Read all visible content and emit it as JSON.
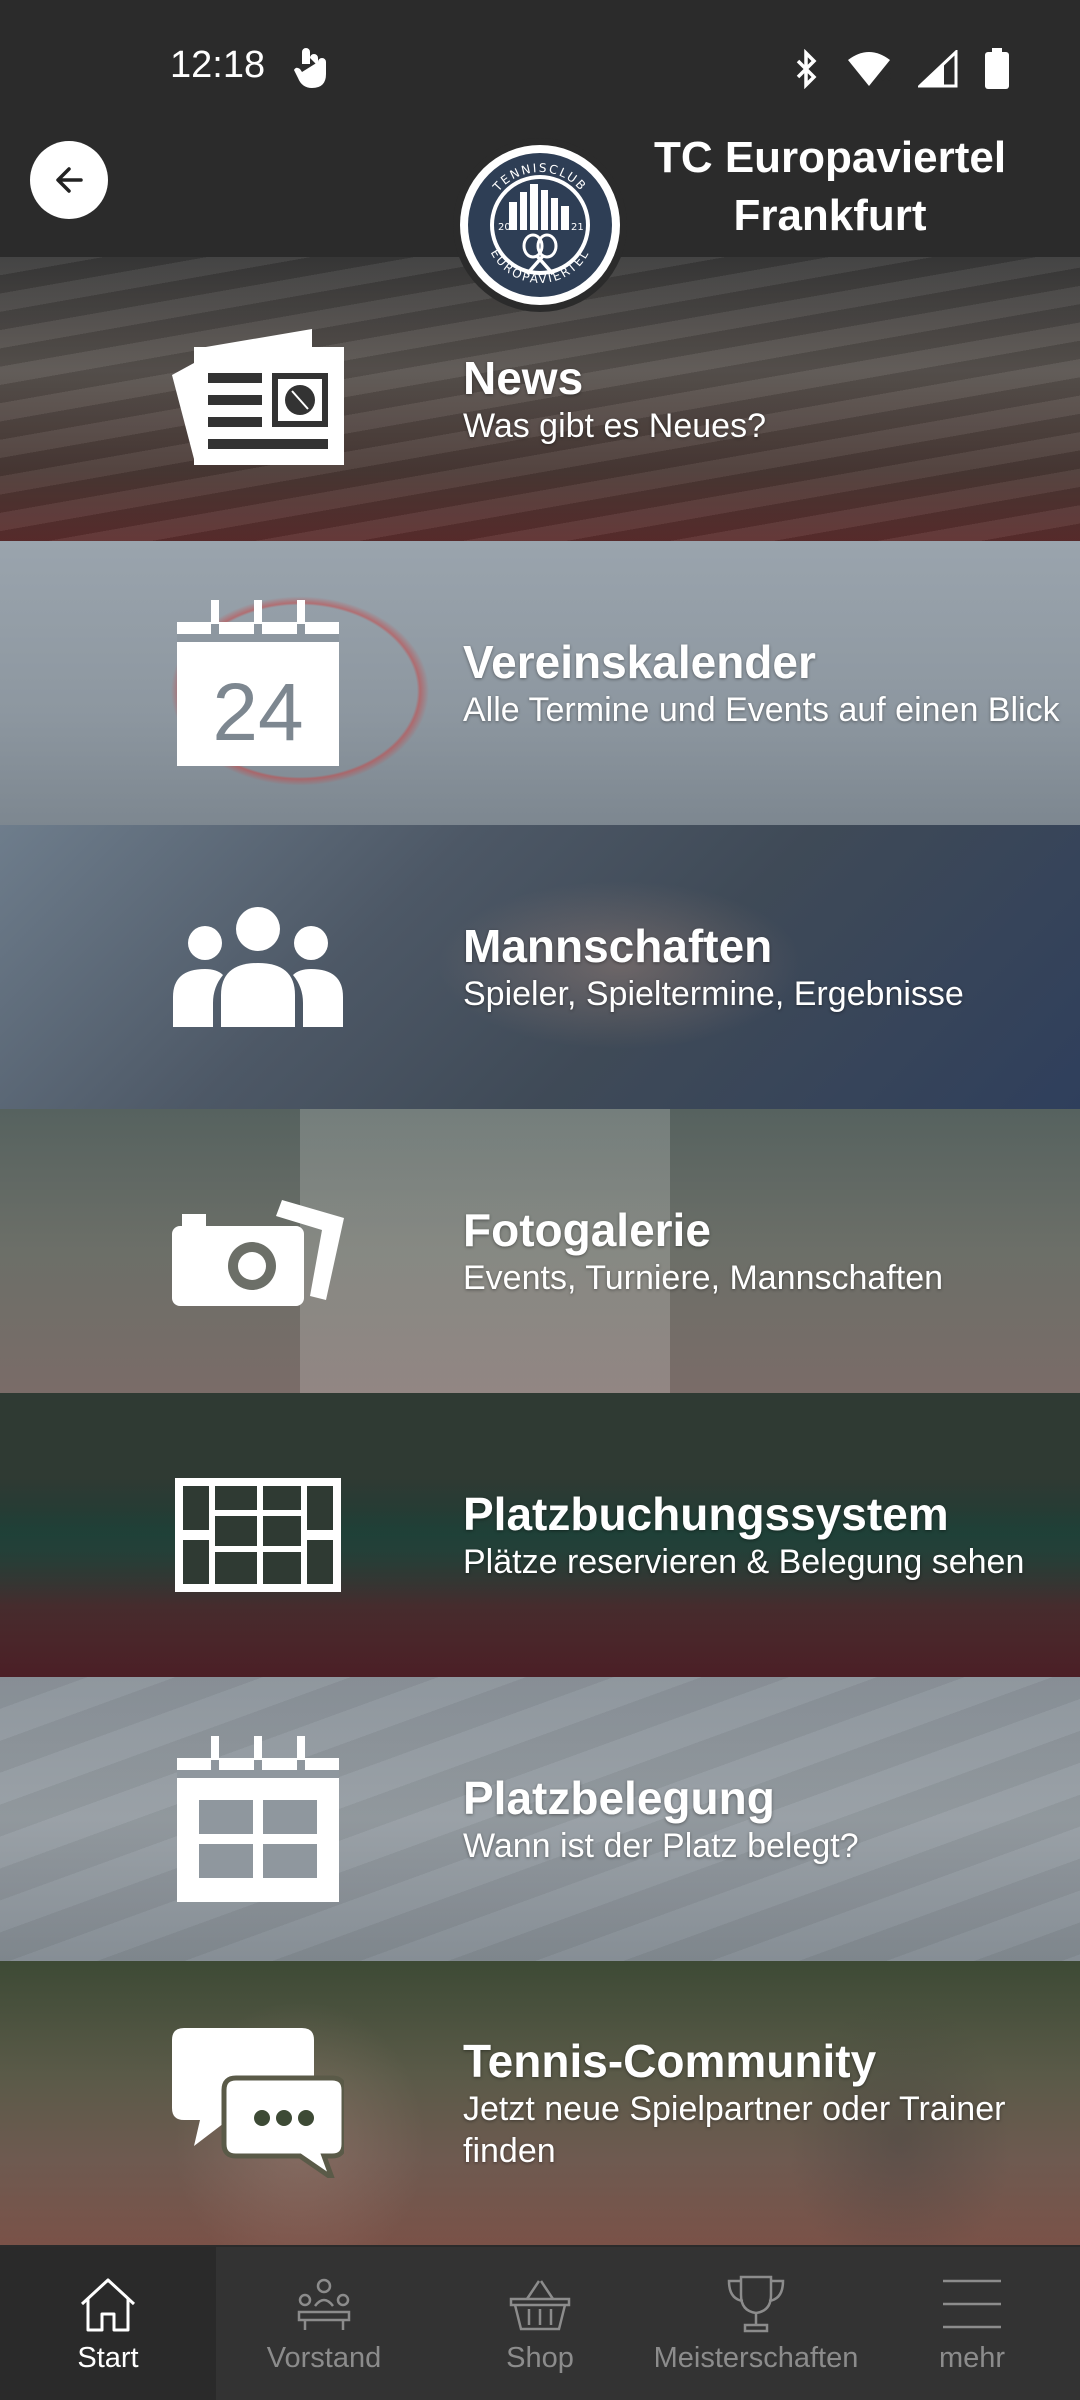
{
  "status": {
    "time": "12:18",
    "icons": [
      "gesture-icon",
      "bluetooth-icon",
      "wifi-icon",
      "signal-icon",
      "battery-icon"
    ]
  },
  "header": {
    "title": "TC Europaviertel Frankfurt",
    "logo": {
      "top_text": "TENNISCLUB",
      "bottom_text": "EUROPAVIERTEL",
      "year_left": "20",
      "year_right": "21"
    }
  },
  "menu": [
    {
      "title": "News",
      "subtitle": "Was gibt es Neues?",
      "icon": "newspaper-icon"
    },
    {
      "title": "Vereinskalender",
      "subtitle": "Alle Termine und Events auf einen Blick",
      "icon": "calendar-24-icon",
      "icon_number": "24"
    },
    {
      "title": "Mannschaften",
      "subtitle": "Spieler, Spieltermine, Ergebnisse",
      "icon": "team-icon"
    },
    {
      "title": "Fotogalerie",
      "subtitle": "Events, Turniere, Mannschaften",
      "icon": "camera-photos-icon"
    },
    {
      "title": "Platzbuchungssystem",
      "subtitle": "Plätze reservieren & Belegung sehen",
      "icon": "court-grid-icon"
    },
    {
      "title": "Platzbelegung",
      "subtitle": "Wann ist der Platz belegt?",
      "icon": "calendar-grid-icon"
    },
    {
      "title": "Tennis-Community",
      "subtitle": "Jetzt neue Spielpartner oder Trainer finden",
      "icon": "chat-bubbles-icon"
    }
  ],
  "nav": [
    {
      "label": "Start",
      "icon": "home-icon",
      "active": true
    },
    {
      "label": "Vorstand",
      "icon": "board-meeting-icon",
      "active": false
    },
    {
      "label": "Shop",
      "icon": "basket-icon",
      "active": false
    },
    {
      "label": "Meisterschaften",
      "icon": "trophy-icon",
      "active": false
    },
    {
      "label": "mehr",
      "icon": "menu-icon",
      "active": false
    }
  ],
  "colors": {
    "background": "#2b2b2b",
    "nav_bg": "#333333",
    "nav_inactive": "#8c8c8c",
    "text": "#ffffff"
  }
}
